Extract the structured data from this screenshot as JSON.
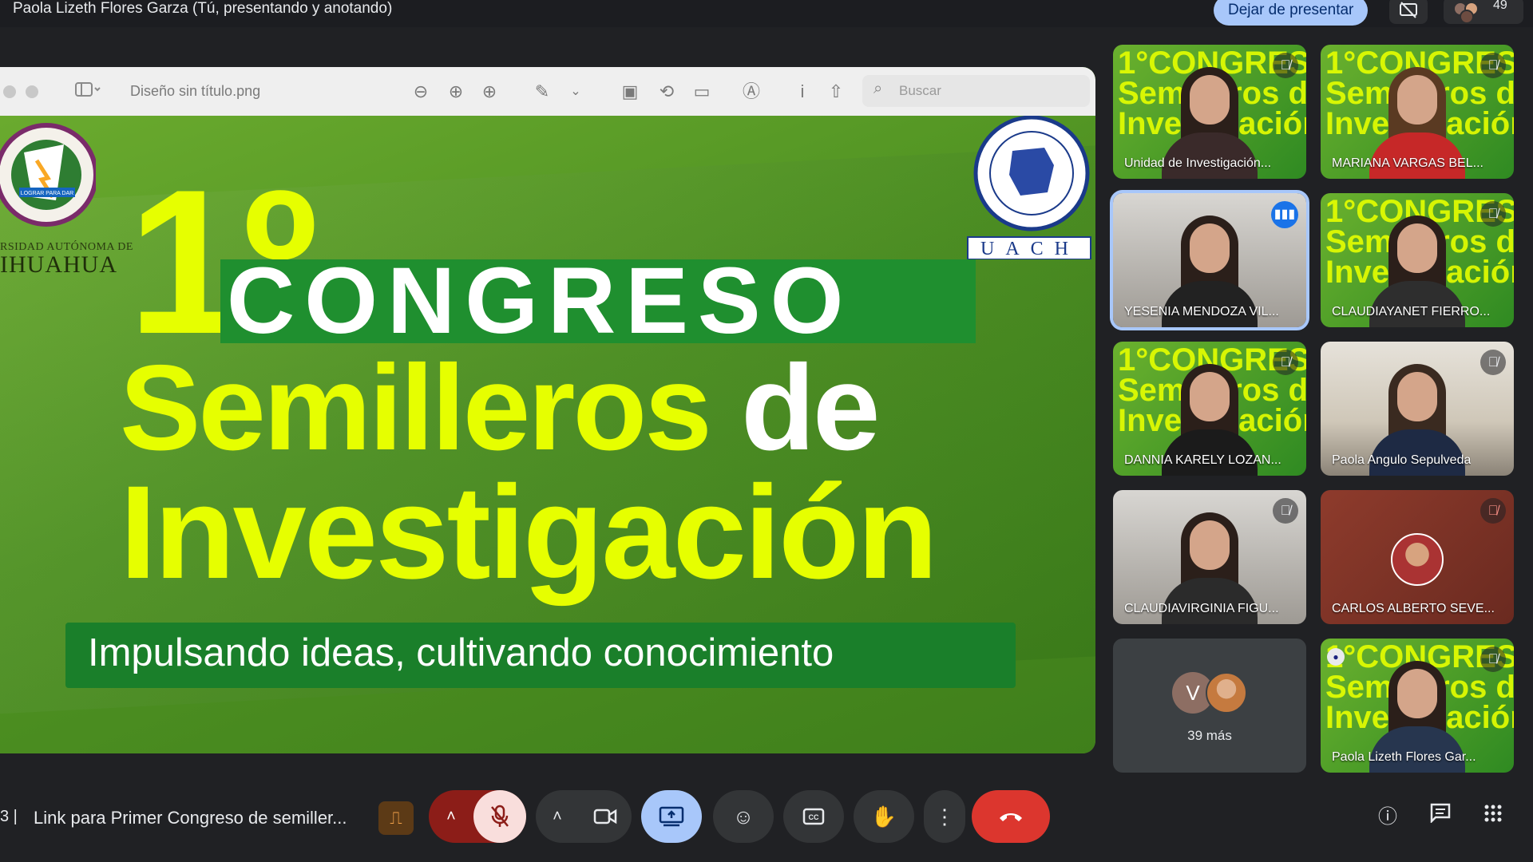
{
  "topbar": {
    "presenter_label": "Paola Lizeth Flores Garza (Tú, presentando y anotando)",
    "stop_presenting": "Dejar de presentar",
    "participant_count": "49"
  },
  "viewer": {
    "file_title": "Diseño sin título.png",
    "search_placeholder": "Buscar"
  },
  "slide": {
    "university_line1": "RSIDAD AUTÓNOMA DE",
    "university_line2": "IHUAHUA",
    "uach_logo_text": "LOGRAR PARA DAR",
    "faculty_text": "UACH",
    "ordinal": "1º",
    "congreso": "CONGRESO",
    "semilleros": "Semilleros",
    "de": "de",
    "investigacion": "Investigación",
    "tagline": "Impulsando ideas, cultivando conocimiento"
  },
  "participants": [
    {
      "name": "Unidad de Investigación...",
      "muted": true,
      "background": "green"
    },
    {
      "name": "MARIANA VARGAS BEL...",
      "muted": true,
      "background": "green"
    },
    {
      "name": "YESENIA MENDOZA VIL...",
      "muted": false,
      "speaking": true,
      "background": "room"
    },
    {
      "name": "CLAUDIAYANET FIERRO...",
      "muted": true,
      "background": "green"
    },
    {
      "name": "DANNIA KARELY LOZAN...",
      "muted": true,
      "background": "green"
    },
    {
      "name": "Paola Angulo Sepulveda",
      "muted": true,
      "background": "office"
    },
    {
      "name": "CLAUDIAVIRGINIA FIGU...",
      "muted": true,
      "background": "room"
    },
    {
      "name": "CARLOS ALBERTO SEVE...",
      "muted": true,
      "background": "brown"
    },
    {
      "name": "Paola Lizeth Flores Gar...",
      "muted": true,
      "background": "green"
    }
  ],
  "overflow_tile": {
    "initial": "V",
    "label": "39 más"
  },
  "bottombar": {
    "code_fragment": "3  |",
    "meeting_title": "Link para Primer Congreso de semiller..."
  },
  "icons": {
    "mute": "mic-off-icon",
    "speaking": "audio-level-icon",
    "camera": "video-camera-icon",
    "present": "present-screen-icon",
    "emoji": "emoji-icon",
    "captions": "closed-captions-icon",
    "hand": "raise-hand-icon",
    "more": "more-vert-icon",
    "leave": "call-end-icon",
    "info": "info-icon",
    "chat": "chat-icon",
    "activities": "apps-grid-icon"
  },
  "colors": {
    "stop_button_bg": "#a8c7fa",
    "leave_button_bg": "#dc362e",
    "mic_off_bg": "#f9dedc",
    "slide_yellow": "#e6ff00",
    "slide_green": "#4f9222"
  }
}
